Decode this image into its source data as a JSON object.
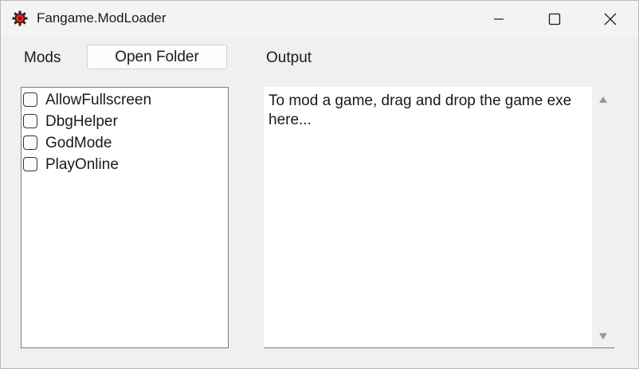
{
  "window": {
    "title": "Fangame.ModLoader",
    "icon": "gear-icon",
    "controls": [
      "minimize-icon",
      "maximize-icon",
      "close-icon"
    ]
  },
  "mods": {
    "label": "Mods",
    "open_folder_label": "Open Folder",
    "items": [
      {
        "label": "AllowFullscreen",
        "checked": false
      },
      {
        "label": "DbgHelper",
        "checked": false
      },
      {
        "label": "GodMode",
        "checked": false
      },
      {
        "label": "PlayOnline",
        "checked": false
      }
    ]
  },
  "output": {
    "label": "Output",
    "text": "To mod a game, drag and drop the game exe here..."
  },
  "colors": {
    "app_icon": "#c0392b",
    "background": "#f0f0f0",
    "text": "#1a1a1a"
  }
}
